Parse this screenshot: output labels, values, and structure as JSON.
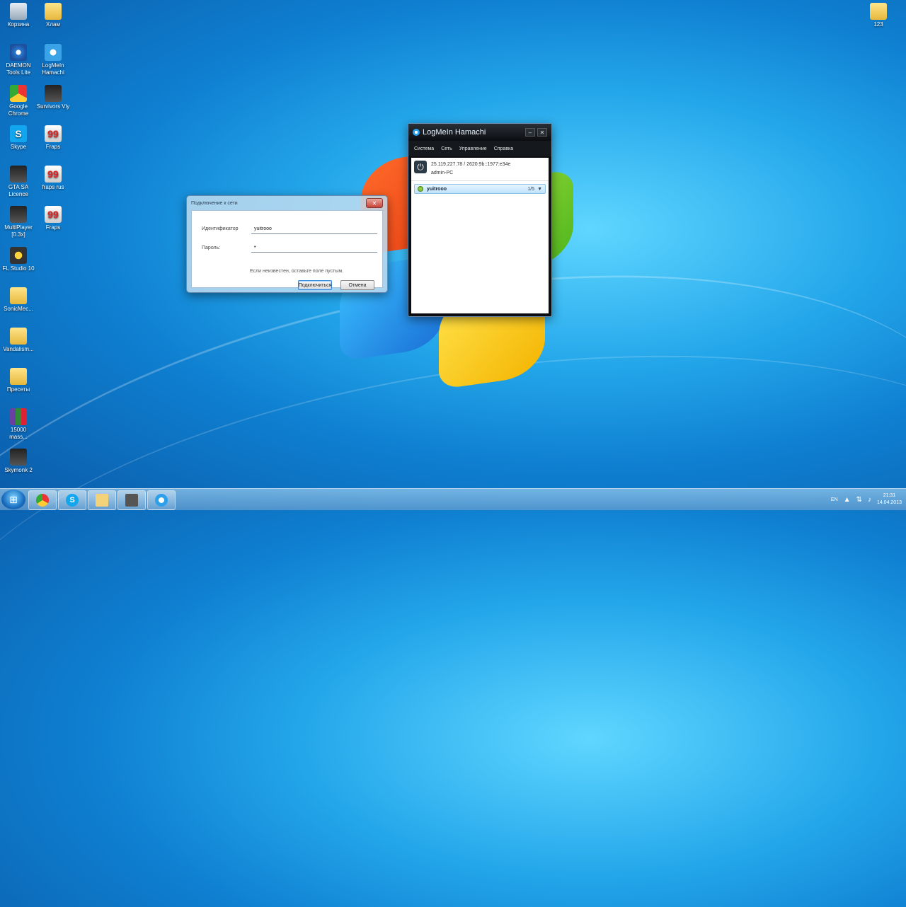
{
  "desktop": {
    "icons_left": [
      {
        "label": "Корзина",
        "icon": "recycle-bin-icon"
      },
      {
        "label": "Хлам",
        "icon": "folder-icon"
      },
      {
        "label": "DAEMON Tools Lite",
        "icon": "daemon-tools-icon"
      },
      {
        "label": "LogMeIn Hamachi",
        "icon": "hamachi-icon"
      },
      {
        "label": "Google Chrome",
        "icon": "chrome-icon"
      },
      {
        "label": "Survivors Viy",
        "icon": "game-icon"
      },
      {
        "label": "Skype",
        "icon": "skype-icon"
      },
      {
        "label": "Fraps",
        "icon": "fraps-icon"
      },
      {
        "label": "GTA SA Licence",
        "icon": "game-icon"
      },
      {
        "label": "fraps rus",
        "icon": "fraps-icon"
      },
      {
        "label": "MultiPlayer [0.3x]",
        "icon": "game-icon"
      },
      {
        "label": "Fraps",
        "icon": "fraps-icon"
      },
      {
        "label": "FL Studio 10",
        "icon": "fl-studio-icon"
      },
      {
        "label": "SonicMec...",
        "icon": "folder-icon"
      },
      {
        "label": "Vandalism...",
        "icon": "folder-icon"
      },
      {
        "label": "Пресеты",
        "icon": "folder-icon"
      },
      {
        "label": "15000 mass...",
        "icon": "winrar-icon"
      },
      {
        "label": "Skymonk 2",
        "icon": "skymonk-icon"
      }
    ],
    "icon_right": {
      "label": "123",
      "icon": "folder-icon"
    }
  },
  "connect_dialog": {
    "title": "Подключение к сети",
    "id_label": "Идентификатор",
    "id_value": "yuitrooo",
    "password_label": "Пароль:",
    "password_value": "•",
    "hint": "Если неизвестен, оставьте поле пустым.",
    "connect_button": "Подключиться",
    "cancel_button": "Отмена",
    "close_glyph": "✕"
  },
  "hamachi": {
    "title": "LogMeIn Hamachi",
    "menu": [
      "Система",
      "Сеть",
      "Управление",
      "Справка"
    ],
    "address": "25.119.227.78 / 2620:9b::1977:e34e",
    "computer_name": "admin-PC",
    "network": {
      "name": "yuitrooo",
      "count": "1/5"
    },
    "minimize_glyph": "–",
    "close_glyph": "✕",
    "power_glyph": "⏻"
  },
  "taskbar": {
    "start_glyph": "⊞",
    "language": "EN",
    "time": "21:31",
    "date": "14.04.2013"
  }
}
